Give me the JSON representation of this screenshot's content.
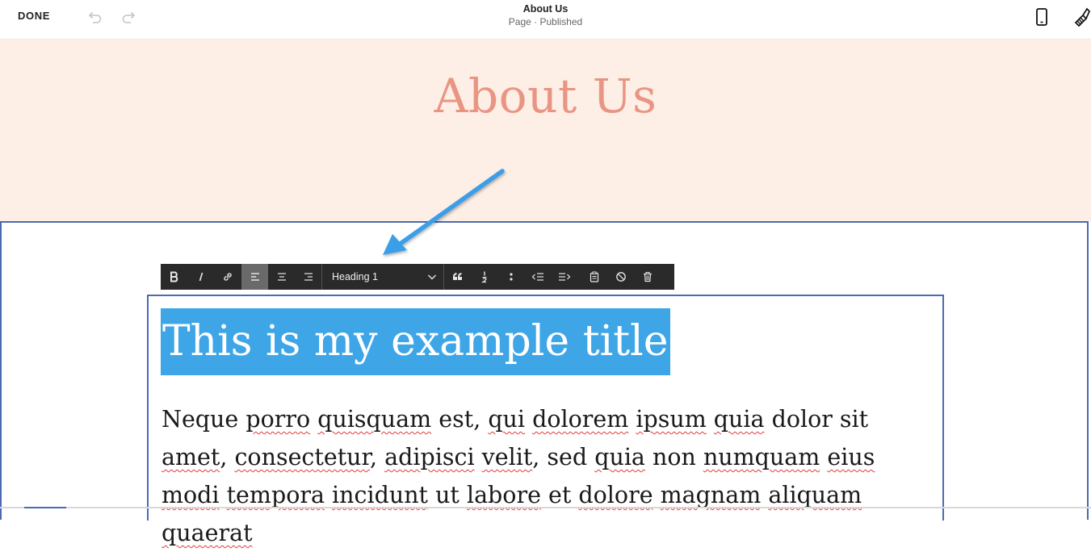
{
  "topbar": {
    "done_label": "DONE",
    "page_title": "About Us",
    "page_status": "Page · Published"
  },
  "header": {
    "heading": "About Us",
    "background_color": "#fdeee6",
    "heading_color": "#e99583"
  },
  "toolbar": {
    "block_format": "Heading 1"
  },
  "content": {
    "title": "This is my example title",
    "body": [
      {
        "t": "Neque",
        "s": false
      },
      {
        "t": " ",
        "s": false
      },
      {
        "t": "porro",
        "s": true
      },
      {
        "t": " ",
        "s": false
      },
      {
        "t": "quisquam",
        "s": true
      },
      {
        "t": " est, ",
        "s": false
      },
      {
        "t": "qui",
        "s": true
      },
      {
        "t": " ",
        "s": false
      },
      {
        "t": "dolorem",
        "s": true
      },
      {
        "t": " ",
        "s": false
      },
      {
        "t": "ipsum",
        "s": true
      },
      {
        "t": " ",
        "s": false
      },
      {
        "t": "quia",
        "s": true
      },
      {
        "t": " dolor sit ",
        "s": false
      },
      {
        "t": "amet",
        "s": true
      },
      {
        "t": ", ",
        "s": false
      },
      {
        "t": "consectetur",
        "s": true
      },
      {
        "t": ", ",
        "s": false
      },
      {
        "t": "adipisci",
        "s": true
      },
      {
        "t": " ",
        "s": false
      },
      {
        "t": "velit",
        "s": true
      },
      {
        "t": ", sed ",
        "s": false
      },
      {
        "t": "quia",
        "s": true
      },
      {
        "t": " non ",
        "s": false
      },
      {
        "t": "numquam",
        "s": true
      },
      {
        "t": " ",
        "s": false
      },
      {
        "t": "eius",
        "s": true
      },
      {
        "t": " ",
        "s": false
      },
      {
        "t": "modi",
        "s": true
      },
      {
        "t": " ",
        "s": false
      },
      {
        "t": "tempora",
        "s": true
      },
      {
        "t": " ",
        "s": false
      },
      {
        "t": "incidunt",
        "s": true
      },
      {
        "t": " ut ",
        "s": false
      },
      {
        "t": "labore",
        "s": true
      },
      {
        "t": " et ",
        "s": false
      },
      {
        "t": "dolore",
        "s": true
      },
      {
        "t": " ",
        "s": false
      },
      {
        "t": "magnam",
        "s": true
      },
      {
        "t": " ",
        "s": false
      },
      {
        "t": "aliquam",
        "s": true
      },
      {
        "t": " ",
        "s": false
      },
      {
        "t": "quaerat",
        "s": true
      }
    ]
  },
  "colors": {
    "selection": "#3ea6e6",
    "block_outline": "#4b6ab3",
    "toolbar_bg": "#2a2a2a",
    "arrow": "#3b9fe8"
  },
  "icons": [
    "undo-icon",
    "redo-icon",
    "mobile-preview-icon",
    "site-styles-icon",
    "bold-icon",
    "italic-icon",
    "link-icon",
    "align-left-icon",
    "align-center-icon",
    "align-right-icon",
    "chevron-down-icon",
    "blockquote-icon",
    "numbered-list-icon",
    "bulleted-list-icon",
    "outdent-icon",
    "indent-icon",
    "paste-plain-text-icon",
    "clear-formatting-icon",
    "trash-icon"
  ]
}
